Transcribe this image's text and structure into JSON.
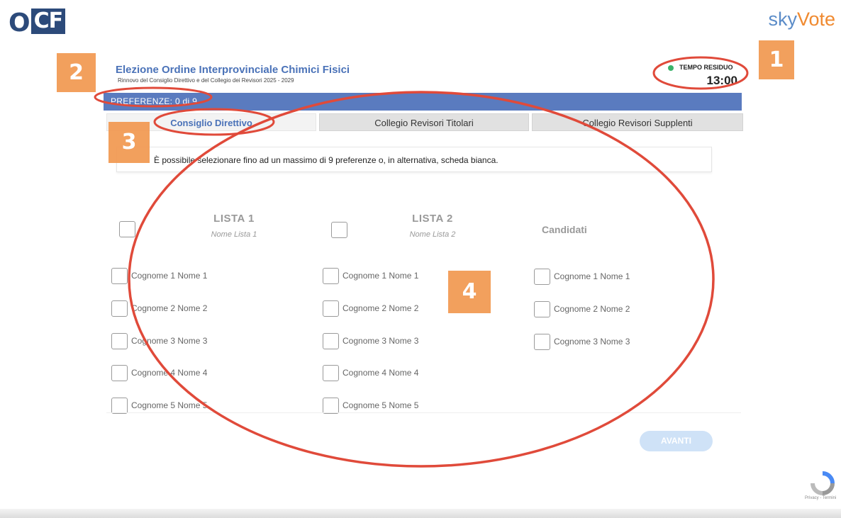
{
  "header": {
    "logo_left_text": "O",
    "logo_left_box": "CF",
    "logo_right_sky": "sky",
    "logo_right_vote": "Vote"
  },
  "election": {
    "title": "Elezione Ordine Interprovinciale Chimici Fisici",
    "subtitle": "Rinnovo del Consiglio Direttivo e del Collegio dei Revisori 2025 - 2029"
  },
  "timer": {
    "label": "TEMPO RESIDUO",
    "value": "13:00",
    "status_color": "#3ab36a"
  },
  "preferences": {
    "text": "PREFERENZE: 0 di 9"
  },
  "tabs": [
    {
      "label": "Consiglio Direttivo",
      "active": true
    },
    {
      "label": "Collegio Revisori Titolari",
      "active": false
    },
    {
      "label": "Collegio Revisori Supplenti",
      "active": false
    }
  ],
  "info": {
    "text": "È possibile selezionare fino ad un massimo di 9 preferenze o, in alternativa, scheda bianca."
  },
  "lists": [
    {
      "title": "LISTA 1",
      "subtitle": "Nome Lista 1",
      "candidates": [
        "Cognome 1 Nome 1",
        "Cognome 2 Nome 2",
        "Cognome 3 Nome 3",
        "Cognome 4 Nome 4",
        "Cognome 5 Nome 5"
      ]
    },
    {
      "title": "LISTA 2",
      "subtitle": "Nome Lista 2",
      "candidates": [
        "Cognome 1 Nome 1",
        "Cognome 2 Nome 2",
        "Cognome 3 Nome 3",
        "Cognome 4 Nome 4",
        "Cognome 5 Nome 5"
      ]
    }
  ],
  "independent": {
    "title": "Candidati",
    "candidates": [
      "Cognome 1 Nome 1",
      "Cognome 2 Nome 2",
      "Cognome 3 Nome 3"
    ]
  },
  "actions": {
    "next_label": "AVANTI"
  },
  "recaptcha": {
    "links": "Privacy - Termini"
  },
  "annotations": {
    "badges": [
      "1",
      "2",
      "3",
      "4"
    ],
    "badge_color": "#f29b55",
    "ring_color": "#e04a3a"
  },
  "colors": {
    "accent": "#5a7bbf",
    "title": "#4a72b8"
  }
}
